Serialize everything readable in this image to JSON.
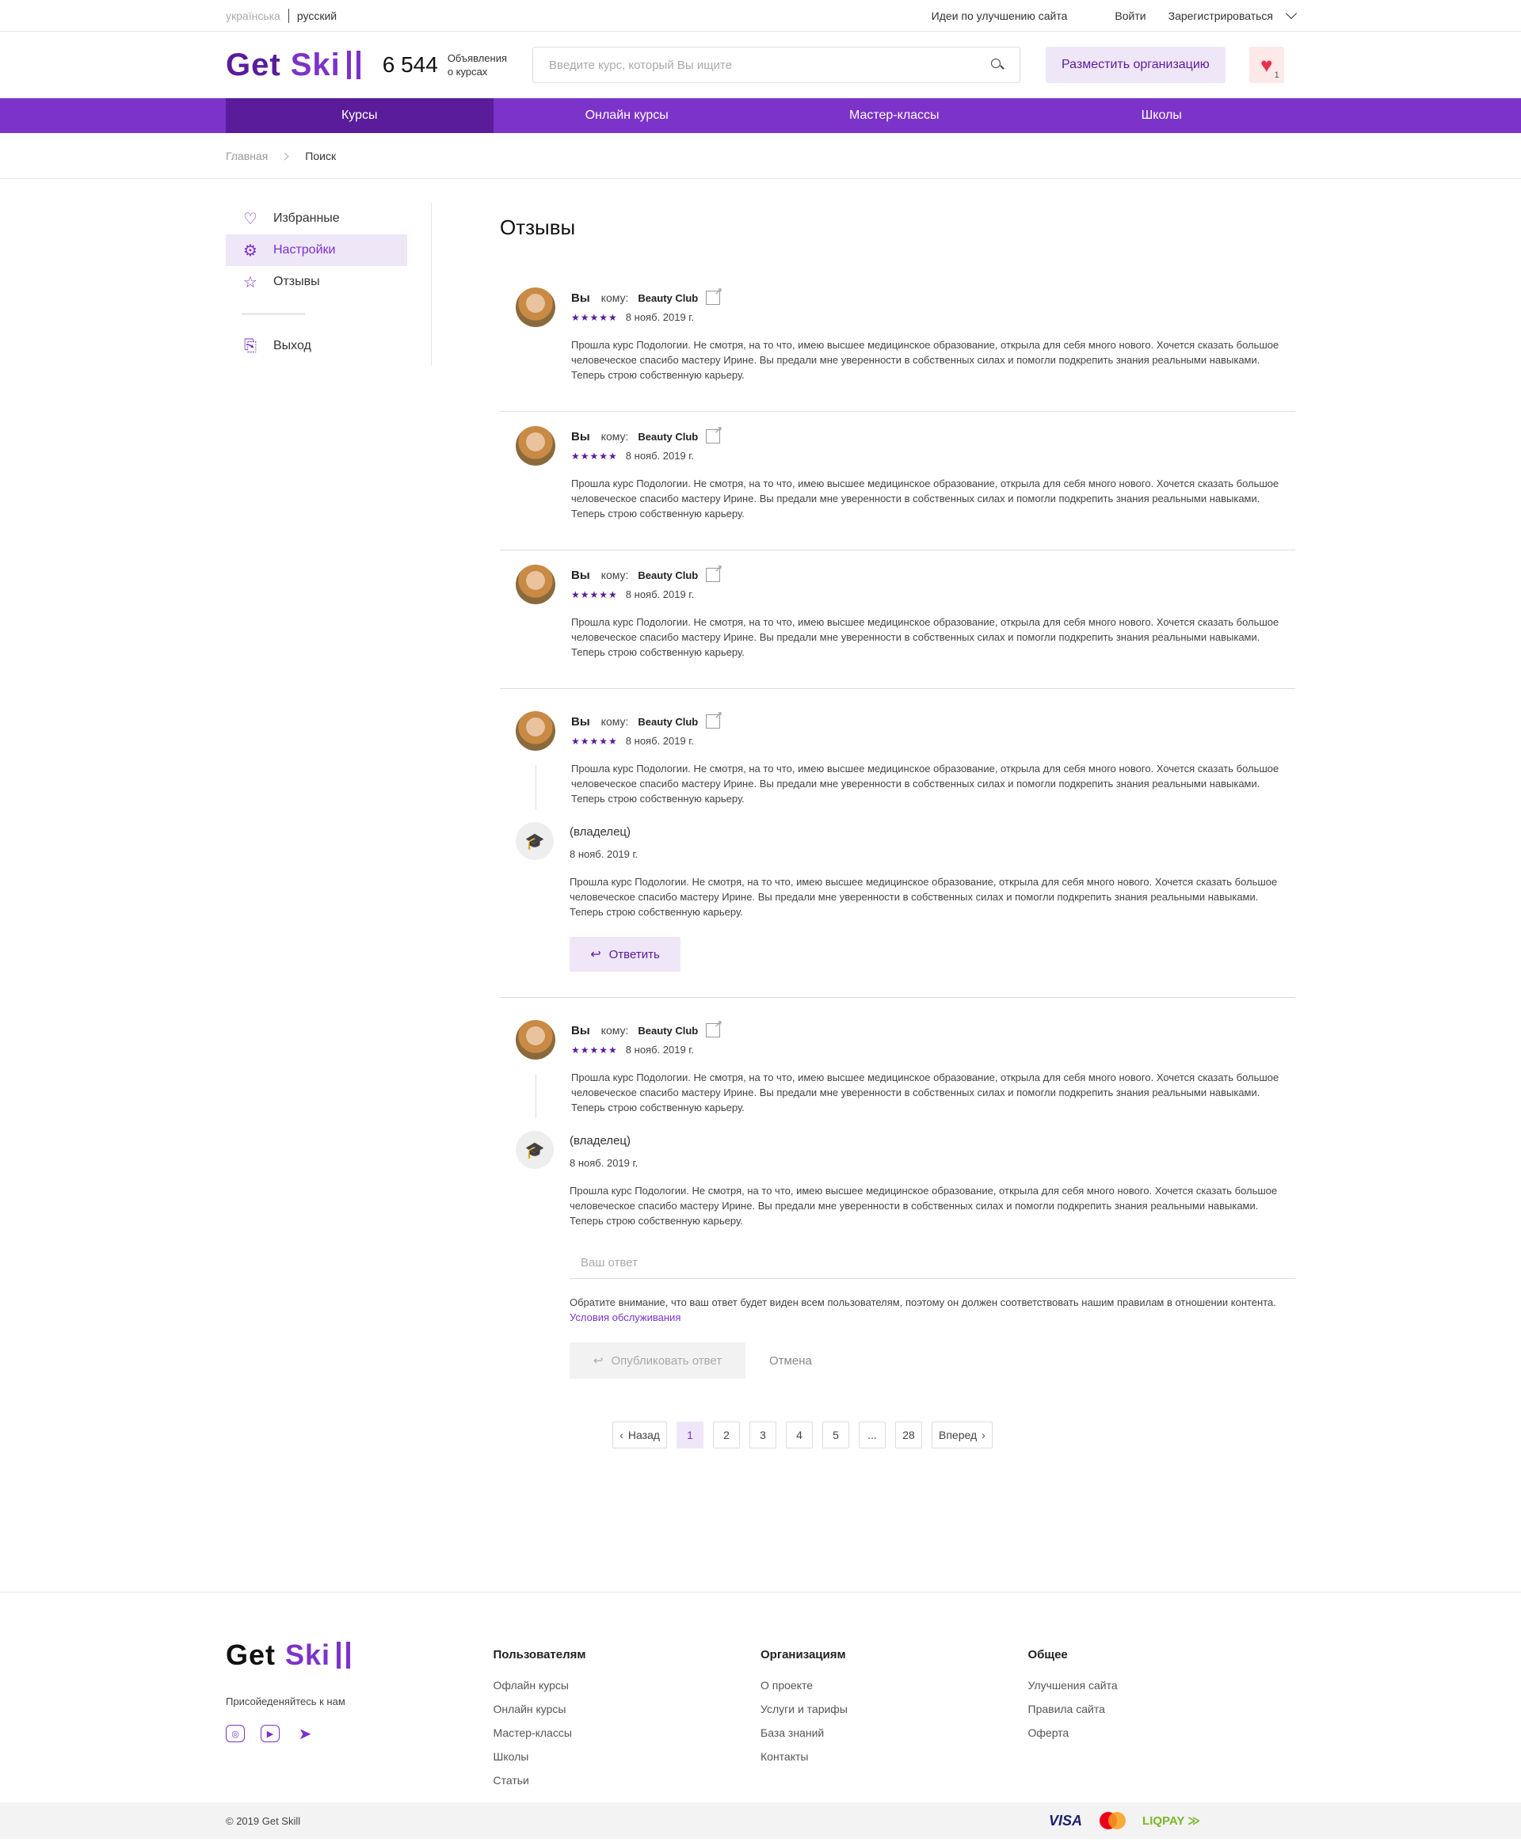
{
  "topbar": {
    "lang_ua": "українська",
    "lang_ru": "русский",
    "ideas": "Идеи по улучшению сайта",
    "login": "Войти",
    "register": "Зарегистрироваться"
  },
  "header": {
    "logo_get": "Get",
    "logo_skill": "Ski",
    "count": "6 544",
    "count_label_1": "Объявления",
    "count_label_2": "о курсах",
    "search_placeholder": "Введите курс, который Вы ищите",
    "place_org": "Разместить организацию",
    "favorites_count": "1"
  },
  "nav": {
    "items": [
      {
        "label": "Курсы"
      },
      {
        "label": "Онлайн курсы"
      },
      {
        "label": "Мастер-классы"
      },
      {
        "label": "Школы"
      }
    ]
  },
  "breadcrumb": {
    "home": "Главная",
    "current": "Поиск"
  },
  "sidebar": {
    "items": [
      {
        "label": "Избранные",
        "icon": "heart-icon"
      },
      {
        "label": "Настройки",
        "icon": "settings-icon"
      },
      {
        "label": "Отзывы",
        "icon": "star-icon"
      },
      {
        "label": "Выход",
        "icon": "logout-icon"
      }
    ]
  },
  "page_title": "Отзывы",
  "review": {
    "you": "Вы",
    "to": "кому:",
    "org": "Beauty Club",
    "stars": "★★★★★",
    "date": "8 нояб. 2019 г.",
    "text": "Прошла курс Подологии. Не смотря, на то что, имею высшее медицинское образование, открыла для себя много нового. Хочется сказать большое человеческое спасибо мастеру Ирине. Вы предали мне уверенности в собственных силах и помогли подкрепить знания реальными навыками. Теперь строю собственную карьеру.",
    "owner": "(владелец)",
    "owner_text": "Прошла курс Подологии. Не смотря, на то что, имею высшее медицинское образование, открыла для себя много нового. Хочется сказать большое человеческое спасибо мастеру Ирине. Вы предали мне уверенности в собственных силах и помогли подкрепить знания реальными навыками. Теперь строю  собственную карьеру.",
    "reply": "Ответить",
    "answer_placeholder": "Ваш ответ",
    "notice": "Обратите внимание, что ваш ответ будет виден всем пользователям, поэтому он должен соответствовать нашим правилам в отношении контента.",
    "terms": "Условия обслуживания",
    "publish": "Опубликовать ответ",
    "cancel": "Отмена"
  },
  "pagination": {
    "prev": "Назад",
    "pages": [
      "1",
      "2",
      "3",
      "4",
      "5",
      "...",
      "28"
    ],
    "next": "Вперед",
    "current": "1"
  },
  "footer": {
    "join": "Присойеденяйтесь к нам",
    "col_users": {
      "title": "Пользователям",
      "links": [
        "Офлайн курсы",
        "Онлайн курсы",
        "Мастер-классы",
        "Школы",
        "Статьи"
      ]
    },
    "col_orgs": {
      "title": "Организациям",
      "links": [
        "О проекте",
        "Услуги и тарифы",
        "База знаний",
        "Контакты"
      ]
    },
    "col_general": {
      "title": "Общее",
      "links": [
        "Улучшения сайта",
        "Правила  сайта",
        "Оферта"
      ]
    },
    "copyright": "© 2019 Get Skill",
    "visa": "VISA",
    "liqpay": "LIQPAY"
  },
  "colors": {
    "brand": "#7b33c9",
    "brand_dark": "#5a1c9a",
    "brand_light": "#efe6f8",
    "heart": "#e8334a"
  }
}
